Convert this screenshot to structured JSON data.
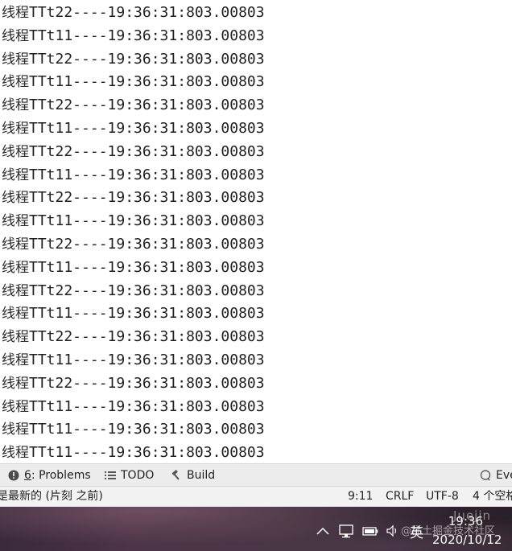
{
  "console": {
    "lines": [
      {
        "prefix": "线程",
        "text": "TTt22----19:36:31:803.00803"
      },
      {
        "prefix": "线程",
        "text": "TTt11----19:36:31:803.00803"
      },
      {
        "prefix": "线程",
        "text": "TTt22----19:36:31:803.00803"
      },
      {
        "prefix": "线程",
        "text": "TTt11----19:36:31:803.00803"
      },
      {
        "prefix": "线程",
        "text": "TTt22----19:36:31:803.00803"
      },
      {
        "prefix": "线程",
        "text": "TTt11----19:36:31:803.00803"
      },
      {
        "prefix": "线程",
        "text": "TTt22----19:36:31:803.00803"
      },
      {
        "prefix": "线程",
        "text": "TTt11----19:36:31:803.00803"
      },
      {
        "prefix": "线程",
        "text": "TTt22----19:36:31:803.00803"
      },
      {
        "prefix": "线程",
        "text": "TTt11----19:36:31:803.00803"
      },
      {
        "prefix": "线程",
        "text": "TTt22----19:36:31:803.00803"
      },
      {
        "prefix": "线程",
        "text": "TTt11----19:36:31:803.00803"
      },
      {
        "prefix": "线程",
        "text": "TTt22----19:36:31:803.00803"
      },
      {
        "prefix": "线程",
        "text": "TTt11----19:36:31:803.00803"
      },
      {
        "prefix": "线程",
        "text": "TTt22----19:36:31:803.00803"
      },
      {
        "prefix": "线程",
        "text": "TTt11----19:36:31:803.00803"
      },
      {
        "prefix": "线程",
        "text": "TTt22----19:36:31:803.00803"
      },
      {
        "prefix": "线程",
        "text": "TTt11----19:36:31:803.00803"
      },
      {
        "prefix": "线程",
        "text": "TTt11----19:36:31:803.00803"
      },
      {
        "prefix": "线程",
        "text": "TTt11----19:36:31:803.00803"
      }
    ]
  },
  "toolwindows": {
    "problems": {
      "mnemonic": "6",
      "label": ": Problems",
      "icon": "problems-icon"
    },
    "todo": {
      "label": "TODO",
      "icon": "list-icon"
    },
    "build": {
      "label": "Build",
      "icon": "hammer-icon"
    },
    "event_log": {
      "label": "Eve",
      "icon": "event-log-icon"
    }
  },
  "status": {
    "message": "是最新的 (片刻 之前)",
    "position": "9:11",
    "line_separator": "CRLF",
    "encoding": "UTF-8",
    "indent": "4 个空格"
  },
  "taskbar": {
    "ime": "英",
    "time": "19:36",
    "date": "2020/10/12",
    "watermark": "@稀土掘金技术社区",
    "watermark_logo": "Juejin"
  },
  "colors": {
    "console_bg": "#ffffff",
    "console_text": "#1f1f1f",
    "toolbar_bg": "#ececec",
    "statusbar_bg": "#f2f2f2",
    "taskbar_bg": "#3a2a3a"
  }
}
